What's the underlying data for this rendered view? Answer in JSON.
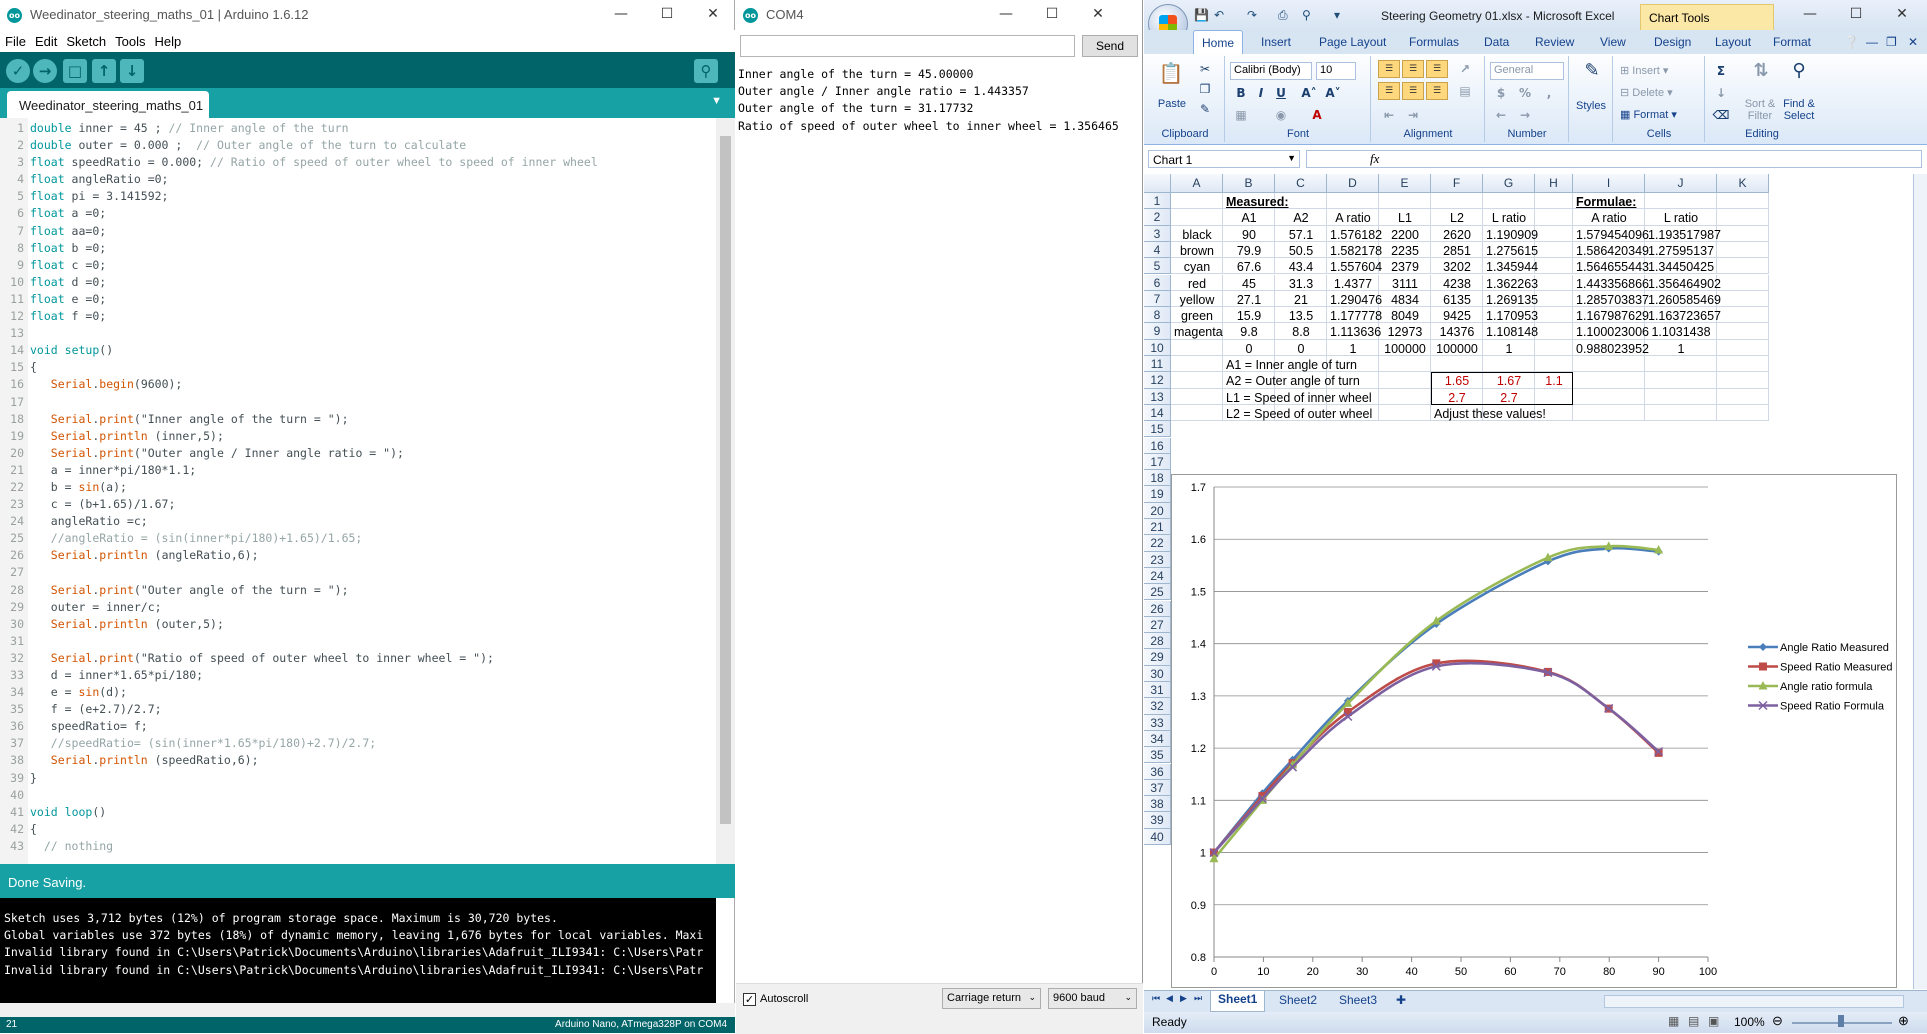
{
  "ide": {
    "title": "Weedinator_steering_maths_01 | Arduino 1.6.12",
    "menu": [
      "File",
      "Edit",
      "Sketch",
      "Tools",
      "Help"
    ],
    "tab_label": "Weedinator_steering_maths_01",
    "status_text": "Done Saving.",
    "console_lines": [
      "Sketch uses 3,712 bytes (12%) of program storage space. Maximum is 30,720 bytes.",
      "Global variables use 372 bytes (18%) of dynamic memory, leaving 1,676 bytes for local variables. Maxi",
      "Invalid library found in C:\\Users\\Patrick\\Documents\\Arduino\\libraries\\Adafruit_ILI9341: C:\\Users\\Patr",
      "Invalid library found in C:\\Users\\Patrick\\Documents\\Arduino\\libraries\\Adafruit_ILI9341: C:\\Users\\Patr"
    ],
    "footer_line": "21",
    "footer_board": "Arduino Nano, ATmega328P on COM4",
    "code": [
      [
        {
          "t": "double",
          "c": "kw"
        },
        {
          "t": " inner = 45 ; "
        },
        {
          "t": "// Inner angle of the turn",
          "c": "cm"
        }
      ],
      [
        {
          "t": "double",
          "c": "kw"
        },
        {
          "t": " outer = 0.000 ;  "
        },
        {
          "t": "// Outer angle of the turn to calculate",
          "c": "cm"
        }
      ],
      [
        {
          "t": "float",
          "c": "kw"
        },
        {
          "t": " speedRatio = 0.000; "
        },
        {
          "t": "// Ratio of speed of outer wheel to speed of inner wheel",
          "c": "cm"
        }
      ],
      [
        {
          "t": "float",
          "c": "kw"
        },
        {
          "t": " angleRatio =0;"
        }
      ],
      [
        {
          "t": "float",
          "c": "kw"
        },
        {
          "t": " pi = 3.141592;"
        }
      ],
      [
        {
          "t": "float",
          "c": "kw"
        },
        {
          "t": " a =0;"
        }
      ],
      [
        {
          "t": "float",
          "c": "kw"
        },
        {
          "t": " aa=0;"
        }
      ],
      [
        {
          "t": "float",
          "c": "kw"
        },
        {
          "t": " b =0;"
        }
      ],
      [
        {
          "t": "float",
          "c": "kw"
        },
        {
          "t": " c =0;"
        }
      ],
      [
        {
          "t": "float",
          "c": "kw"
        },
        {
          "t": " d =0;"
        }
      ],
      [
        {
          "t": "float",
          "c": "kw"
        },
        {
          "t": " e =0;"
        }
      ],
      [
        {
          "t": "float",
          "c": "kw"
        },
        {
          "t": " f =0;"
        }
      ],
      [],
      [
        {
          "t": "void",
          "c": "kw"
        },
        {
          "t": " "
        },
        {
          "t": "setup",
          "c": "kw"
        },
        {
          "t": "()"
        }
      ],
      [
        {
          "t": "{"
        }
      ],
      [
        {
          "t": "   "
        },
        {
          "t": "Serial",
          "c": "fn"
        },
        {
          "t": "."
        },
        {
          "t": "begin",
          "c": "fn"
        },
        {
          "t": "(9600);"
        }
      ],
      [],
      [
        {
          "t": "   "
        },
        {
          "t": "Serial",
          "c": "fn"
        },
        {
          "t": "."
        },
        {
          "t": "print",
          "c": "fn"
        },
        {
          "t": "(\"Inner angle of the turn = \");"
        }
      ],
      [
        {
          "t": "   "
        },
        {
          "t": "Serial",
          "c": "fn"
        },
        {
          "t": "."
        },
        {
          "t": "println",
          "c": "fn"
        },
        {
          "t": " (inner,5);"
        }
      ],
      [
        {
          "t": "   "
        },
        {
          "t": "Serial",
          "c": "fn"
        },
        {
          "t": "."
        },
        {
          "t": "print",
          "c": "fn"
        },
        {
          "t": "(\"Outer angle / Inner angle ratio = \");"
        }
      ],
      [
        {
          "t": "   a = inner*pi/180*1.1;"
        }
      ],
      [
        {
          "t": "   b = "
        },
        {
          "t": "sin",
          "c": "fn"
        },
        {
          "t": "(a);"
        }
      ],
      [
        {
          "t": "   c = (b+1.65)/1.67;"
        }
      ],
      [
        {
          "t": "   angleRatio =c;"
        }
      ],
      [
        {
          "t": "   "
        },
        {
          "t": "//angleRatio = (sin(inner*pi/180)+1.65)/1.65;",
          "c": "cm"
        }
      ],
      [
        {
          "t": "   "
        },
        {
          "t": "Serial",
          "c": "fn"
        },
        {
          "t": "."
        },
        {
          "t": "println",
          "c": "fn"
        },
        {
          "t": " (angleRatio,6);"
        }
      ],
      [],
      [
        {
          "t": "   "
        },
        {
          "t": "Serial",
          "c": "fn"
        },
        {
          "t": "."
        },
        {
          "t": "print",
          "c": "fn"
        },
        {
          "t": "(\"Outer angle of the turn = \");"
        }
      ],
      [
        {
          "t": "   outer = inner/c;"
        }
      ],
      [
        {
          "t": "   "
        },
        {
          "t": "Serial",
          "c": "fn"
        },
        {
          "t": "."
        },
        {
          "t": "println",
          "c": "fn"
        },
        {
          "t": " (outer,5);"
        }
      ],
      [],
      [
        {
          "t": "   "
        },
        {
          "t": "Serial",
          "c": "fn"
        },
        {
          "t": "."
        },
        {
          "t": "print",
          "c": "fn"
        },
        {
          "t": "(\"Ratio of speed of outer wheel to inner wheel = \");"
        }
      ],
      [
        {
          "t": "   d = inner*1.65*pi/180;"
        }
      ],
      [
        {
          "t": "   e = "
        },
        {
          "t": "sin",
          "c": "fn"
        },
        {
          "t": "(d);"
        }
      ],
      [
        {
          "t": "   f = (e+2.7)/2.7;"
        }
      ],
      [
        {
          "t": "   speedRatio= f;"
        }
      ],
      [
        {
          "t": "   "
        },
        {
          "t": "//speedRatio= (sin(inner*1.65*pi/180)+2.7)/2.7;",
          "c": "cm"
        }
      ],
      [
        {
          "t": "   "
        },
        {
          "t": "Serial",
          "c": "fn"
        },
        {
          "t": "."
        },
        {
          "t": "println",
          "c": "fn"
        },
        {
          "t": " (speedRatio,6);"
        }
      ],
      [
        {
          "t": "}"
        }
      ],
      [],
      [
        {
          "t": "void",
          "c": "kw"
        },
        {
          "t": " "
        },
        {
          "t": "loop",
          "c": "kw"
        },
        {
          "t": "()"
        }
      ],
      [
        {
          "t": "{"
        }
      ],
      [
        {
          "t": "  "
        },
        {
          "t": "// nothing",
          "c": "cm"
        }
      ]
    ]
  },
  "serial": {
    "title": "COM4",
    "send_label": "Send",
    "output_lines": [
      "Inner angle of the turn = 45.00000",
      "Outer angle / Inner angle ratio = 1.443357",
      "Outer angle of the turn = 31.17732",
      "Ratio of speed of outer wheel to inner wheel = 1.356465"
    ],
    "autoscroll_label": "Autoscroll",
    "line_ending": "Carriage return",
    "baud": "9600 baud"
  },
  "excel": {
    "title": "Steering Geometry 01.xlsx - Microsoft Excel",
    "chart_tools": "Chart Tools",
    "tabs": [
      "Home",
      "Insert",
      "Page Layout",
      "Formulas",
      "Data",
      "Review",
      "View",
      "Design",
      "Layout",
      "Format"
    ],
    "ribbon": {
      "paste": "Paste",
      "clipboard": "Clipboard",
      "font_name": "Calibri (Body)",
      "font_size": "10",
      "font": "Font",
      "alignment": "Alignment",
      "number_format": "General",
      "number": "Number",
      "styles": "Styles",
      "insert": "Insert",
      "delete": "Delete",
      "format": "Format",
      "cells": "Cells",
      "sort_filter": "Sort & Filter",
      "find_select": "Find & Select",
      "editing": "Editing"
    },
    "namebox": "Chart 1",
    "fx": "fx",
    "columns": [
      "A",
      "B",
      "C",
      "D",
      "E",
      "F",
      "G",
      "H",
      "I",
      "J",
      "K"
    ],
    "row_numbers": [
      "1",
      "2",
      "3",
      "4",
      "5",
      "6",
      "7",
      "8",
      "9",
      "10",
      "11",
      "12",
      "13",
      "14",
      "15",
      "16",
      "17",
      "18",
      "19",
      "20",
      "21",
      "22",
      "23",
      "24",
      "25",
      "26",
      "27",
      "28",
      "29",
      "30",
      "31",
      "32",
      "33",
      "34",
      "35",
      "36",
      "37",
      "38",
      "39",
      "40"
    ],
    "cells": {
      "measured_label": "Measured:",
      "formulae_label": "Formulae:",
      "headers": [
        "A1",
        "A2",
        "A ratio",
        "L1",
        "L2",
        "L ratio"
      ],
      "formula_headers": [
        "A ratio",
        "L ratio"
      ],
      "rows": [
        [
          "black",
          "90",
          "57.1",
          "1.576182",
          "2200",
          "2620",
          "1.190909",
          "1.579454096",
          "1.193517987"
        ],
        [
          "brown",
          "79.9",
          "50.5",
          "1.582178",
          "2235",
          "2851",
          "1.275615",
          "1.586420349",
          "1.27595137"
        ],
        [
          "cyan",
          "67.6",
          "43.4",
          "1.557604",
          "2379",
          "3202",
          "1.345944",
          "1.564655443",
          "1.34450425"
        ],
        [
          "red",
          "45",
          "31.3",
          "1.4377",
          "3111",
          "4238",
          "1.362263",
          "1.443356866",
          "1.356464902"
        ],
        [
          "yellow",
          "27.1",
          "21",
          "1.290476",
          "4834",
          "6135",
          "1.269135",
          "1.285703837",
          "1.260585469"
        ],
        [
          "green",
          "15.9",
          "13.5",
          "1.177778",
          "8049",
          "9425",
          "1.170953",
          "1.167987629",
          "1.163723657"
        ],
        [
          "magenta",
          "9.8",
          "8.8",
          "1.113636",
          "12973",
          "14376",
          "1.108148",
          "1.100023006",
          "1.1031438"
        ],
        [
          "",
          "0",
          "0",
          "1",
          "100000",
          "100000",
          "1",
          "0.988023952",
          "1"
        ]
      ],
      "notes": [
        "A1 = Inner angle of turn",
        "A2 = Outer angle of turn",
        "L1 = Speed of inner wheel",
        "L2 = Speed of outer wheel"
      ],
      "adjust_row12": [
        "1.65",
        "1.67",
        "1.1"
      ],
      "adjust_row13": [
        "2.7",
        "2.7"
      ],
      "adjust_note": "Adjust these values!"
    },
    "sheets": [
      "Sheet1",
      "Sheet2",
      "Sheet3"
    ],
    "status_ready": "Ready",
    "zoom": "100%"
  },
  "chart_data": {
    "type": "line",
    "title": "",
    "xlabel": "",
    "ylabel": "",
    "xlim": [
      0,
      100
    ],
    "ylim": [
      0.8,
      1.7
    ],
    "xticks": [
      "0",
      "10",
      "20",
      "30",
      "40",
      "50",
      "60",
      "70",
      "80",
      "90",
      "100"
    ],
    "yticks": [
      "0.8",
      "0.9",
      "1",
      "1.1",
      "1.2",
      "1.3",
      "1.4",
      "1.5",
      "1.6",
      "1.7"
    ],
    "grid": true,
    "legend_position": "right",
    "series": [
      {
        "name": "Angle Ratio Measured",
        "color": "#4a7ebb",
        "marker": "diamond",
        "x": [
          0,
          9.8,
          15.9,
          27.1,
          45,
          67.6,
          79.9,
          90
        ],
        "y": [
          1,
          1.113636,
          1.177778,
          1.290476,
          1.4377,
          1.557604,
          1.582178,
          1.576182
        ]
      },
      {
        "name": "Speed Ratio Measured",
        "color": "#be4b48",
        "marker": "square",
        "x": [
          0,
          9.8,
          15.9,
          27.1,
          45,
          67.6,
          79.9,
          90
        ],
        "y": [
          1,
          1.108148,
          1.170953,
          1.269135,
          1.362263,
          1.345944,
          1.275615,
          1.190909
        ]
      },
      {
        "name": "Angle ratio formula",
        "color": "#98b954",
        "marker": "triangle",
        "x": [
          0,
          9.8,
          15.9,
          27.1,
          45,
          67.6,
          79.9,
          90
        ],
        "y": [
          0.988023952,
          1.100023006,
          1.167987629,
          1.285703837,
          1.443356866,
          1.564655443,
          1.586420349,
          1.579454096
        ]
      },
      {
        "name": "Speed Ratio Formula",
        "color": "#7d60a0",
        "marker": "x",
        "x": [
          0,
          9.8,
          15.9,
          27.1,
          45,
          67.6,
          79.9,
          90
        ],
        "y": [
          1,
          1.1031438,
          1.163723657,
          1.260585469,
          1.356464902,
          1.34450425,
          1.27595137,
          1.193517987
        ]
      }
    ]
  }
}
